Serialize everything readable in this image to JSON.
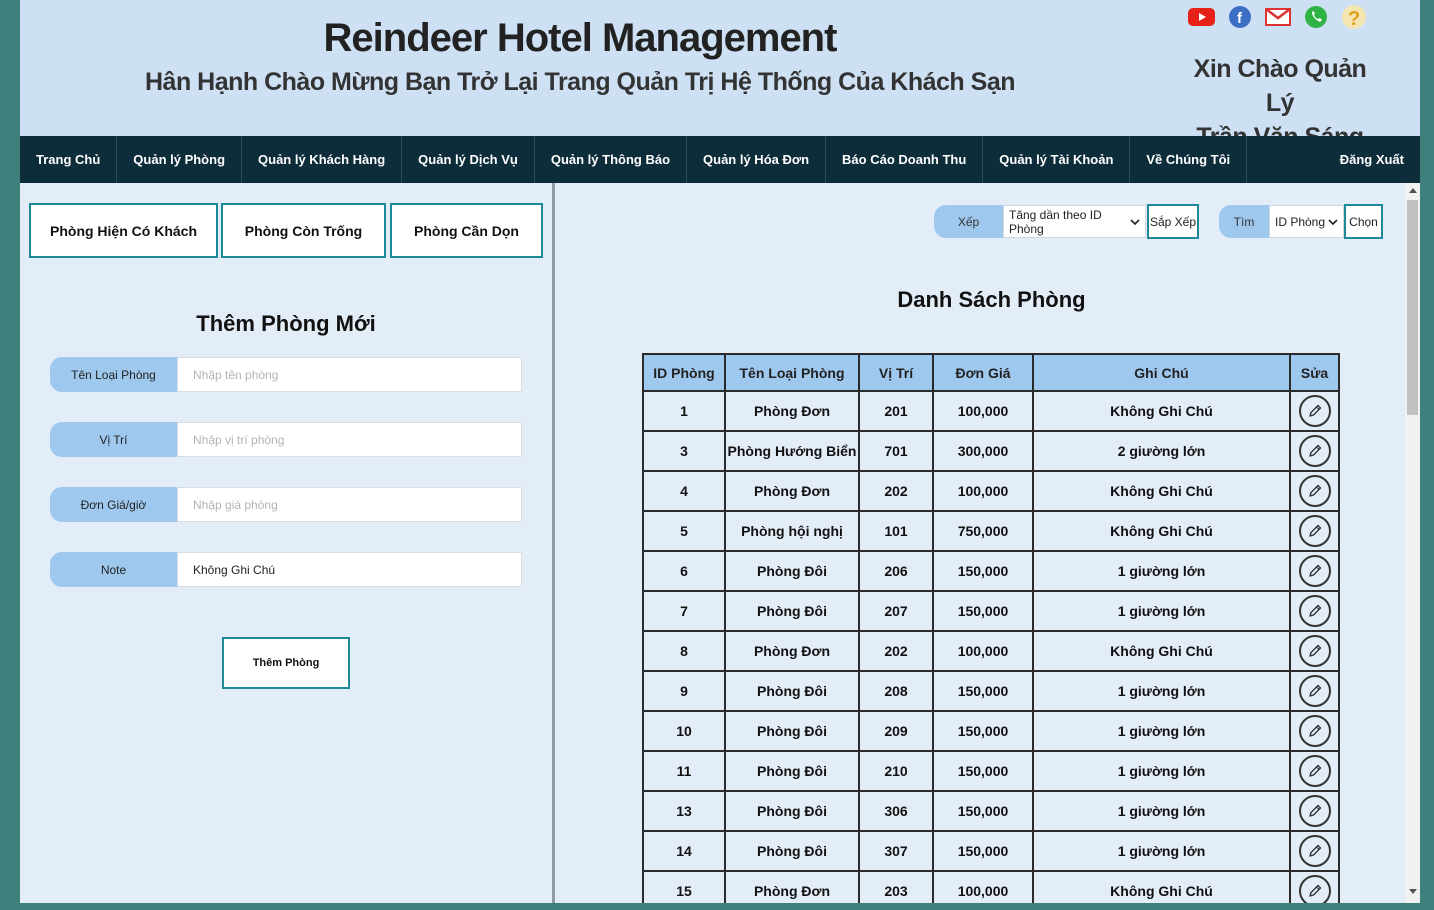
{
  "header": {
    "title": "Reindeer Hotel Management",
    "subtitle": "Hân Hạnh Chào Mừng Bạn Trở Lại Trang Quản Trị Hệ Thống Của Khách Sạn",
    "greeting_line1": "Xin Chào Quản Lý",
    "greeting_line2": "Trần Văn Sáng",
    "social_icons": [
      "youtube-icon",
      "facebook-icon",
      "gmail-icon",
      "whatsapp-icon",
      "help-icon"
    ]
  },
  "nav": {
    "items": [
      "Trang Chủ",
      "Quản lý Phòng",
      "Quản lý Khách Hàng",
      "Quản lý Dịch Vụ",
      "Quản lý Thông Báo",
      "Quản lý Hóa Đơn",
      "Báo Cáo Doanh Thu",
      "Quản lý Tài Khoản",
      "Về Chúng Tôi"
    ],
    "logout": "Đăng Xuất"
  },
  "left": {
    "tabs": [
      "Phòng Hiện Có Khách",
      "Phòng Còn Trống",
      "Phòng Cần Dọn"
    ],
    "form_title": "Thêm Phòng Mới",
    "fields": [
      {
        "label": "Tên Loại Phòng",
        "placeholder": "Nhập tên phòng",
        "value": ""
      },
      {
        "label": "Vị Trí",
        "placeholder": "Nhập vị trí phòng",
        "value": ""
      },
      {
        "label": "Đơn Giá/giờ",
        "placeholder": "Nhập giá phòng",
        "value": ""
      },
      {
        "label": "Note",
        "placeholder": "",
        "value": "Không Ghi Chú"
      }
    ],
    "add_button": "Thêm Phòng"
  },
  "right": {
    "sort_label": "Xếp",
    "sort_value": "Tăng dần theo ID Phòng",
    "sort_button": "Sắp Xếp",
    "search_label": "Tìm",
    "search_value": "ID Phòng",
    "search_button": "Chọn",
    "list_title": "Danh Sách Phòng",
    "columns": [
      "ID Phòng",
      "Tên Loại Phòng",
      "Vị Trí",
      "Đơn Giá",
      "Ghi Chú",
      "Sửa"
    ],
    "rows": [
      [
        "1",
        "Phòng Đơn",
        "201",
        "100,000",
        "Không Ghi Chú"
      ],
      [
        "3",
        "Phòng Hướng Biển",
        "701",
        "300,000",
        "2 giường lớn"
      ],
      [
        "4",
        "Phòng Đơn",
        "202",
        "100,000",
        "Không Ghi Chú"
      ],
      [
        "5",
        "Phòng hội nghị",
        "101",
        "750,000",
        "Không Ghi Chú"
      ],
      [
        "6",
        "Phòng Đôi",
        "206",
        "150,000",
        "1 giường lớn"
      ],
      [
        "7",
        "Phòng Đôi",
        "207",
        "150,000",
        "1 giường lớn"
      ],
      [
        "8",
        "Phòng Đơn",
        "202",
        "100,000",
        "Không Ghi Chú"
      ],
      [
        "9",
        "Phòng Đôi",
        "208",
        "150,000",
        "1 giường lớn"
      ],
      [
        "10",
        "Phòng Đôi",
        "209",
        "150,000",
        "1 giường lớn"
      ],
      [
        "11",
        "Phòng Đôi",
        "210",
        "150,000",
        "1 giường lớn"
      ],
      [
        "13",
        "Phòng Đôi",
        "306",
        "150,000",
        "1 giường lớn"
      ],
      [
        "14",
        "Phòng Đôi",
        "307",
        "150,000",
        "1 giường lớn"
      ],
      [
        "15",
        "Phòng Đơn",
        "203",
        "100,000",
        "Không Ghi Chú"
      ]
    ]
  }
}
